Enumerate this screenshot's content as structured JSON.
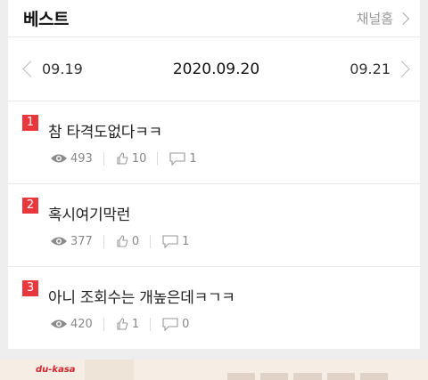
{
  "header": {
    "title": "베스트",
    "channel_home": "채널홈"
  },
  "datebar": {
    "prev": "09.19",
    "current": "2020.09.20",
    "next": "09.21"
  },
  "posts": [
    {
      "rank": "1",
      "title": "참 타격도없다ㅋㅋ",
      "views": "493",
      "likes": "10",
      "comments": "1"
    },
    {
      "rank": "2",
      "title": "혹시여기막런",
      "views": "377",
      "likes": "0",
      "comments": "1"
    },
    {
      "rank": "3",
      "title": "아니 조회수는 개높은데ㅋㄱㅋ",
      "views": "420",
      "likes": "1",
      "comments": "0"
    }
  ],
  "ad": {
    "brand": "du-kasa"
  }
}
